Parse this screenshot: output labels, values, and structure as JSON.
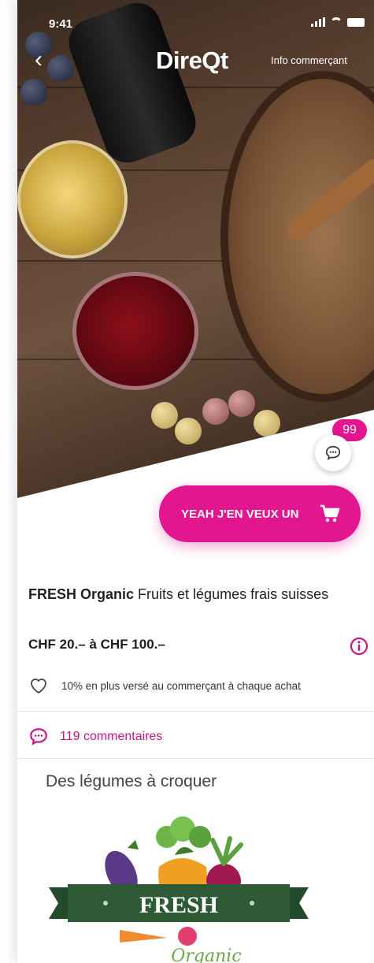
{
  "status_bar": {
    "time": "9:41"
  },
  "nav": {
    "back_glyph": "‹",
    "brand": "DireQt",
    "info_link": "Info commerçant"
  },
  "comments_badge": "99",
  "cta": {
    "label": "YEAH J'EN VEUX UN"
  },
  "product": {
    "brand": "FRESH Organic",
    "description": " Fruits et légumes frais suisses",
    "price": "CHF 20.– à CHF 100.–",
    "bonus": "10% en plus versé au commerçant à chaque achat"
  },
  "comments": {
    "label": "119 commentaires"
  },
  "section": {
    "title": "Des légumes à croquer"
  },
  "logo": {
    "text": "FRESH",
    "subtext": "Organic"
  },
  "colors": {
    "accent": "#e2168f",
    "accent_text": "#c8157f",
    "logo_banner": "#2e5a36"
  },
  "icons": {
    "back": "chevron-left-icon",
    "cart": "cart-icon",
    "comment": "comment-bubble-icon",
    "info": "info-circle-icon",
    "heart": "heart-outline-icon"
  }
}
